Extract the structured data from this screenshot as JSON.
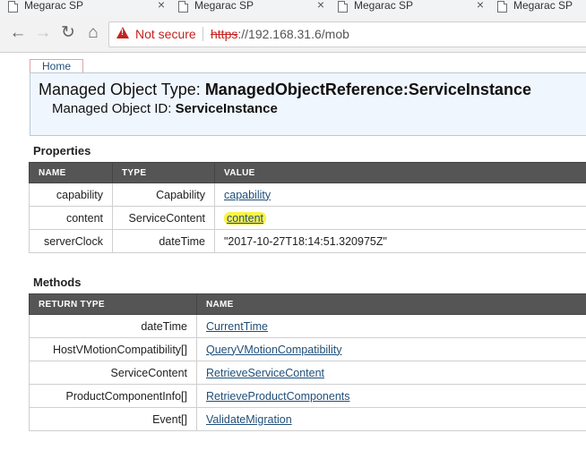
{
  "browser": {
    "tabs": [
      {
        "title": "Megarac SP"
      },
      {
        "title": "Megarac SP"
      },
      {
        "title": "Megarac SP"
      },
      {
        "title": "Megarac SP"
      }
    ],
    "security_label": "Not secure",
    "url_protocol": "https",
    "url_rest": "://192.168.31.6/mob",
    "colors": {
      "warning": "#c5221f"
    }
  },
  "page": {
    "home_tab": "Home",
    "object_type_label": "Managed Object Type:",
    "object_type_value": "ManagedObjectReference:ServiceInstance",
    "object_id_label": "Managed Object ID:",
    "object_id_value": "ServiceInstance",
    "properties": {
      "heading": "Properties",
      "columns": [
        "NAME",
        "TYPE",
        "VALUE"
      ],
      "rows": [
        {
          "name": "capability",
          "type": "Capability",
          "value": "capability"
        },
        {
          "name": "content",
          "type": "ServiceContent",
          "value": "content"
        },
        {
          "name": "serverClock",
          "type": "dateTime",
          "value": "\"2017-10-27T18:14:51.320975Z\""
        }
      ]
    },
    "methods": {
      "heading": "Methods",
      "columns": [
        "RETURN TYPE",
        "NAME"
      ],
      "rows": [
        {
          "return_type": "dateTime",
          "name": "CurrentTime"
        },
        {
          "return_type": "HostVMotionCompatibility[]",
          "name": "QueryVMotionCompatibility"
        },
        {
          "return_type": "ServiceContent",
          "name": "RetrieveServiceContent"
        },
        {
          "return_type": "ProductComponentInfo[]",
          "name": "RetrieveProductComponents"
        },
        {
          "return_type": "Event[]",
          "name": "ValidateMigration"
        }
      ]
    }
  }
}
